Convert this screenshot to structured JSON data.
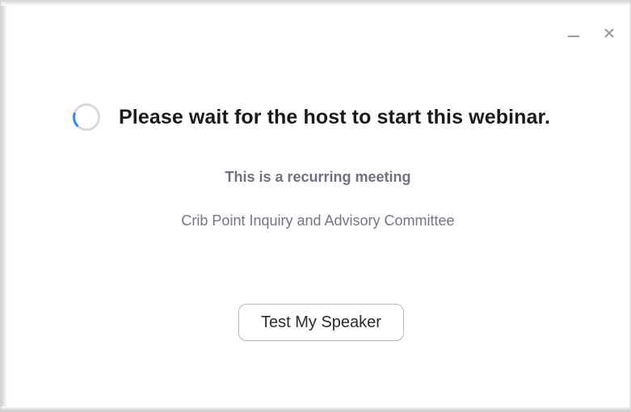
{
  "window": {
    "controls": {
      "minimize_icon": "minimize-icon",
      "close_icon": "close-icon"
    }
  },
  "main": {
    "spinner_icon": "loading-spinner-icon",
    "headline": "Please wait for the host to start this webinar.",
    "recurring_note": "This is a recurring meeting",
    "meeting_name": "Crib Point Inquiry and Advisory Committee",
    "test_speaker_label": "Test My Speaker"
  },
  "colors": {
    "spinner_track": "#d9d9d9",
    "spinner_accent": "#2d8cff",
    "headline": "#1a1a1a",
    "subtext": "#747687"
  }
}
